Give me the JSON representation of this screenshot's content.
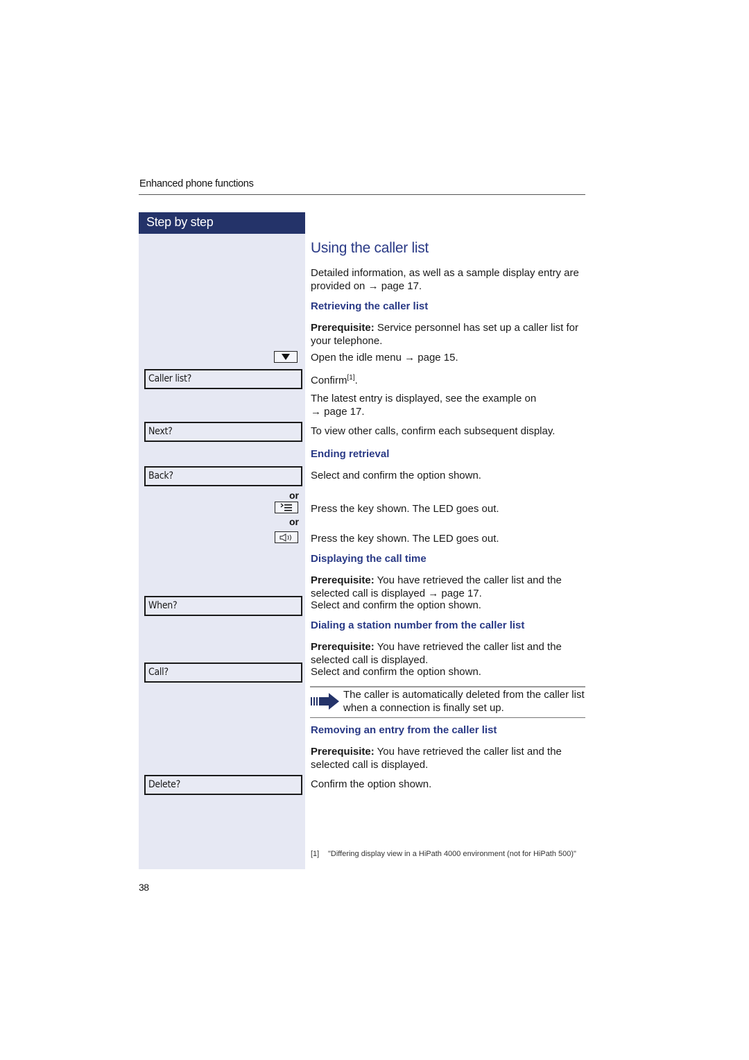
{
  "header": {
    "section": "Enhanced phone functions"
  },
  "sidebar": {
    "title": "Step by step",
    "display_options": {
      "caller_list": "Caller list?",
      "next": "Next?",
      "back": "Back?",
      "when": "When?",
      "call": "Call?",
      "delete": "Delete?"
    },
    "or_label": "or",
    "keys": [
      "down-arrow-key",
      "menu-key",
      "speaker-key"
    ]
  },
  "main": {
    "title": "Using the caller list",
    "intro": {
      "text": "Detailed information, as well as a sample display entry are provided on ",
      "arrow": "→",
      "ref": " page 17."
    },
    "sections": [
      {
        "heading": "Retrieving the caller list",
        "prereq_label": "Prerequisite:",
        "prereq_text": " Service personnel has set up a caller list for your telephone.",
        "steps": [
          {
            "text": "Open the idle menu ",
            "arrow": "→",
            "ref": " page 15."
          },
          {
            "text": "Confirm",
            "footnote_ref": "[1]",
            "suffix": "."
          },
          {
            "text": "The latest entry is displayed, see the example on ",
            "arrow": "→",
            "ref": " page 17."
          },
          {
            "text": "To view other calls, confirm each subsequent display."
          }
        ]
      },
      {
        "heading": "Ending retrieval",
        "steps": [
          {
            "text": "Select and confirm the option shown."
          },
          {
            "text": "Press the key shown. The LED goes out."
          },
          {
            "text": "Press the key shown. The LED goes out."
          }
        ]
      },
      {
        "heading": "Displaying the call time",
        "prereq_label": "Prerequisite:",
        "prereq_text": " You have retrieved the caller list and the selected call is displayed ",
        "prereq_arrow": "→",
        "prereq_ref": " page 17.",
        "steps": [
          {
            "text": "Select and confirm the option shown."
          }
        ]
      },
      {
        "heading": "Dialing a station number from the caller list",
        "prereq_label": "Prerequisite:",
        "prereq_text": " You have retrieved the caller list and the selected call is displayed.",
        "steps": [
          {
            "text": "Select and confirm the option shown."
          }
        ],
        "note": "The caller is automatically deleted from the caller list when a connection is finally set up."
      },
      {
        "heading": "Removing an entry from the caller list",
        "prereq_label": "Prerequisite:",
        "prereq_text": " You have retrieved the caller list and the selected call is displayed.",
        "steps": [
          {
            "text": "Confirm the option shown."
          }
        ]
      }
    ],
    "footnote": {
      "marker": "[1]",
      "text": "\"Differing display view in a HiPath 4000 environment (not for HiPath 500)\""
    }
  },
  "page_number": "38",
  "colors": {
    "accent": "#2a3a86",
    "sidebar_head": "#243369",
    "sidebar_bg": "#e6e8f3"
  }
}
